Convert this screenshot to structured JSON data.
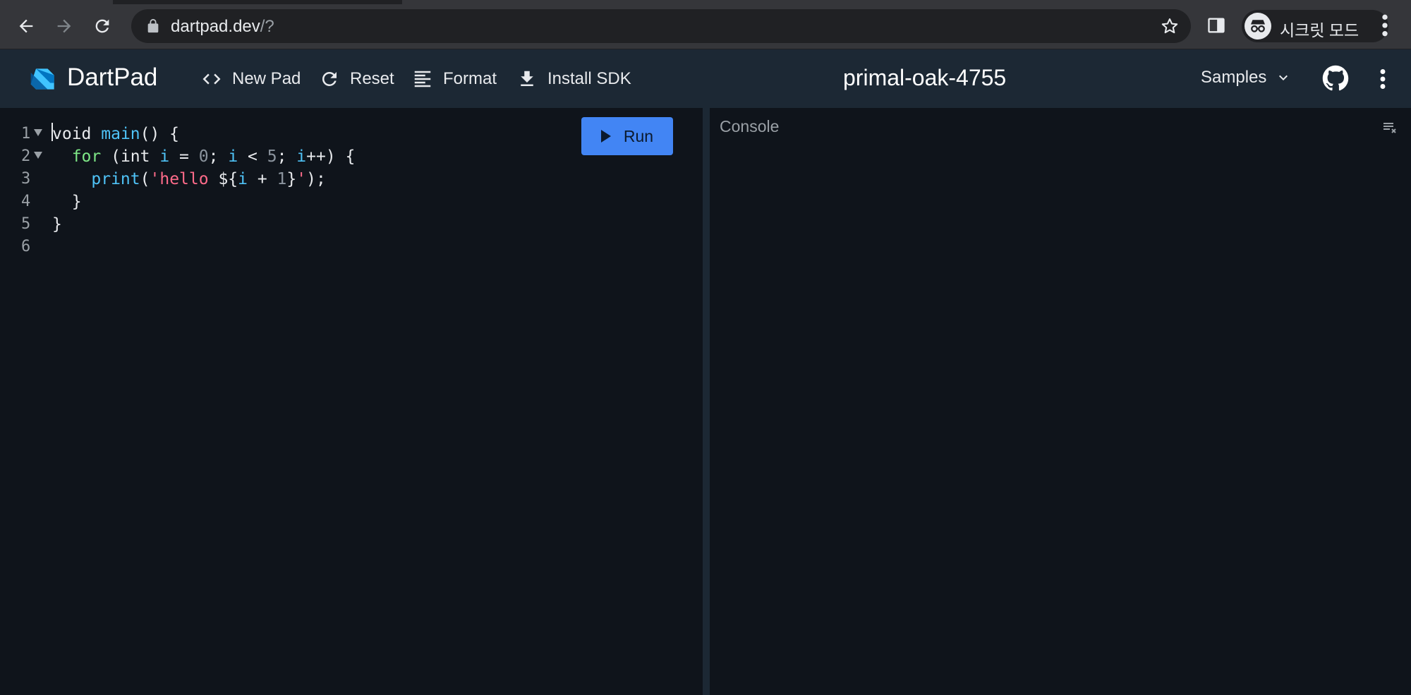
{
  "browser": {
    "url_host": "dartpad.dev",
    "url_path": "/?",
    "profile_label": "시크릿 모드"
  },
  "app": {
    "name": "DartPad",
    "toolbar": {
      "new_pad": "New Pad",
      "reset": "Reset",
      "format": "Format",
      "install_sdk": "Install SDK"
    },
    "pad_title": "primal-oak-4755",
    "samples_label": "Samples"
  },
  "editor": {
    "run_label": "Run",
    "line_numbers": [
      "1",
      "2",
      "3",
      "4",
      "5",
      "6"
    ],
    "code": {
      "l1_kw": "void",
      "l1_fn": "main",
      "l1_rest": "() {",
      "l2_ctl": "for",
      "l2_a": " (int ",
      "l2_i1": "i",
      "l2_b": " = ",
      "l2_n0": "0",
      "l2_c": "; ",
      "l2_i2": "i",
      "l2_d": " < ",
      "l2_n5": "5",
      "l2_e": "; ",
      "l2_i3": "i",
      "l2_f": "++) {",
      "l3_fn": "print",
      "l3_a": "(",
      "l3_str1": "'hello ",
      "l3_interp1": "${",
      "l3_var": "i",
      "l3_op": " + ",
      "l3_n1": "1",
      "l3_interp2": "}",
      "l3_str2": "'",
      "l3_end": ");",
      "l4": "}",
      "l5": "}"
    }
  },
  "console": {
    "title": "Console"
  },
  "colors": {
    "accent": "#4285f4",
    "header_bg": "#1c2834",
    "editor_bg": "#0f141b"
  }
}
